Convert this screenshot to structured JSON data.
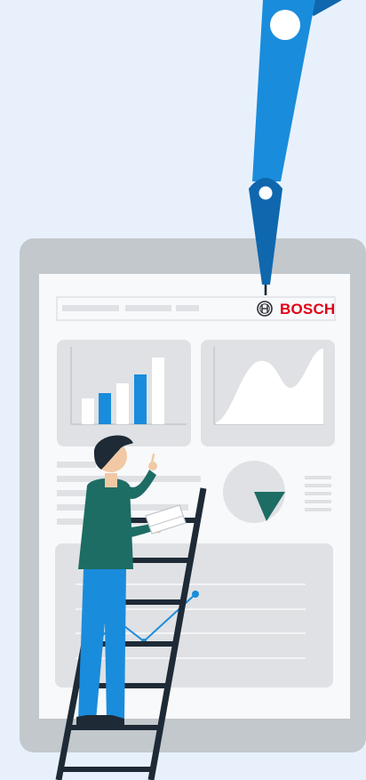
{
  "brand": {
    "name": "BOSCH",
    "color": "#e20015"
  },
  "colors": {
    "background": "#e8f1fb",
    "tablet_frame": "#c3c8cc",
    "screen": "#f8f9fb",
    "card": "#dfe1e4",
    "accent_blue": "#1a8cdc",
    "robot_arm_light": "#1a8cdc",
    "robot_arm_dark": "#0f67ae",
    "chart_dark_green": "#1d6d64",
    "person_shirt": "#1d6d64",
    "person_pants": "#1a8cdc",
    "ladder": "#1e2a36"
  },
  "icons": [
    "robot-arm-icon",
    "bosch-logo-icon",
    "person-icon",
    "ladder-icon",
    "book-icon"
  ]
}
